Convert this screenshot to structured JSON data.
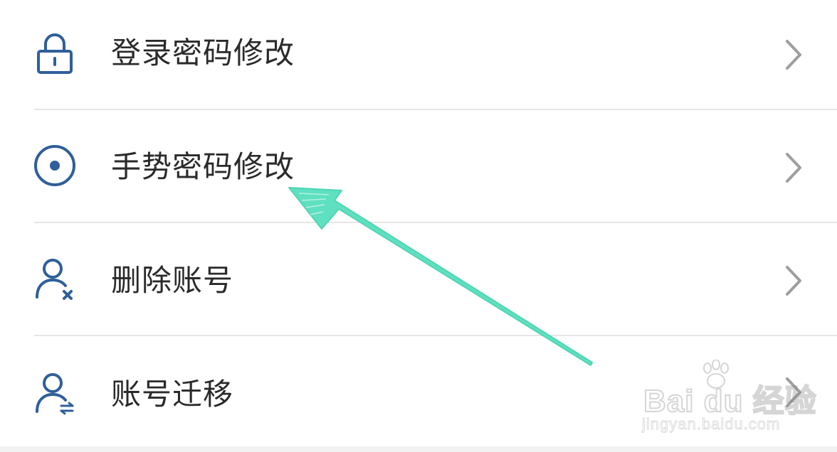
{
  "menu": {
    "items": [
      {
        "label": "登录密码修改",
        "icon": "lock-icon"
      },
      {
        "label": "手势密码修改",
        "icon": "gesture-target-icon"
      },
      {
        "label": "删除账号",
        "icon": "user-remove-icon"
      },
      {
        "label": "账号迁移",
        "icon": "user-transfer-icon"
      }
    ],
    "chevron_icon": "chevron-right-icon"
  },
  "colors": {
    "icon": "#2f5f9a",
    "label": "#2a2a2a",
    "chevron": "#9e9e9e",
    "divider": "#e6e6e6",
    "annotation_arrow": "#5fe0c0"
  },
  "watermark": {
    "logo": "Bai du 经验",
    "url": "jingyan.baidu.com"
  }
}
